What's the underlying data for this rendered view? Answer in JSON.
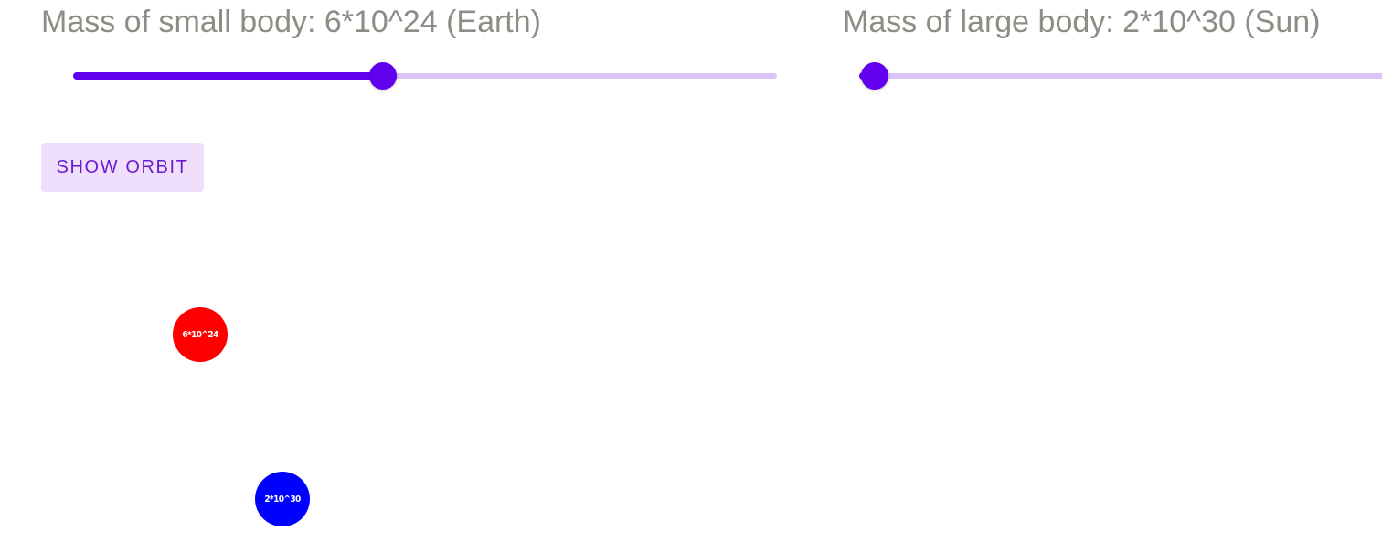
{
  "small_body": {
    "label": "Mass of small body: 6*10^24 (Earth)",
    "slider_fraction": 0.44,
    "circle_label": "6*10^24",
    "circle_color": "#ff0000"
  },
  "large_body": {
    "label": "Mass of large body: 2*10^30 (Sun)",
    "slider_fraction": 0.03,
    "circle_label": "2*10^30",
    "circle_color": "#0000ff"
  },
  "controls": {
    "show_orbit_label": "Show orbit"
  },
  "colors": {
    "label_text": "#8a8f86",
    "slider_active": "#6200ee",
    "slider_inactive": "#d9c4f7",
    "button_bg": "#efdffc",
    "button_text": "#6a1bcf"
  }
}
